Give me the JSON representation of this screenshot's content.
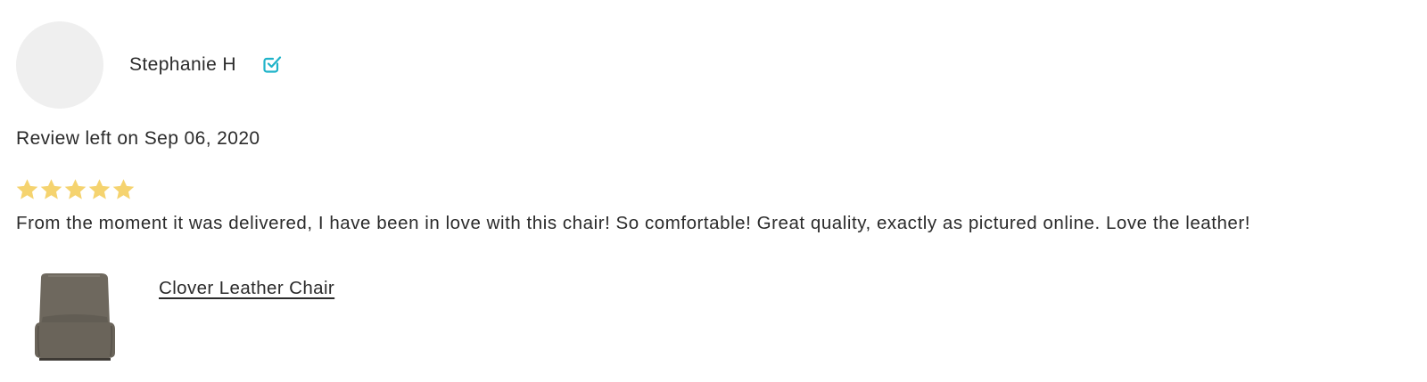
{
  "reviewer": {
    "name": "Stephanie H",
    "verified_icon": "verified-check-icon"
  },
  "review": {
    "date_text": "Review left on Sep 06, 2020",
    "rating": 5,
    "rating_max": 5,
    "body": "From the moment it was delivered, I have been in love with this chair! So comfortable! Great quality, exactly as pictured online. Love the leather!"
  },
  "product": {
    "name": "Clover Leather Chair"
  },
  "colors": {
    "text": "#2b2b2b",
    "avatar_bg": "#efefef",
    "verified": "#1fb3c9",
    "star": "#f5d36f",
    "chair": "#6e685e"
  }
}
